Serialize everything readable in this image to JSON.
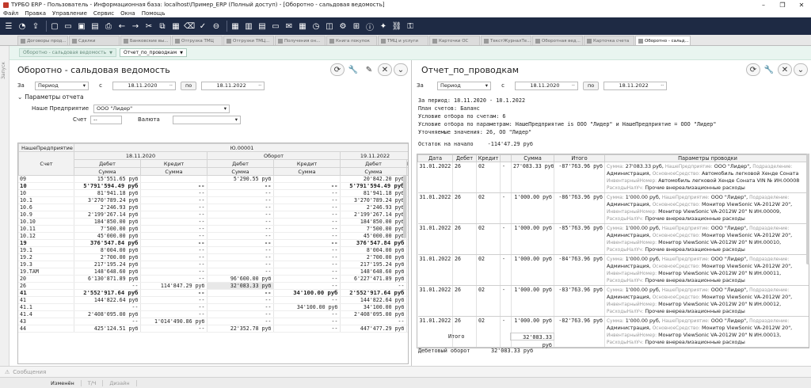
{
  "window": {
    "title": "ТУРБО ERP - Пользователь - Информационная база: localhost\\Пример_ERP (Полный доступ) - [Оборотно - сальдовая ведомость]"
  },
  "menu": [
    "Файл",
    "Правка",
    "Управление",
    "Сервис",
    "Окна",
    "Помощь"
  ],
  "doc_tabs": [
    {
      "label": "Договоры прод..."
    },
    {
      "label": "Сделки"
    },
    {
      "label": "Банковские вы..."
    },
    {
      "label": "Отгрузка ТМЦ"
    },
    {
      "label": "Отгрузки ТМЦ..."
    },
    {
      "label": "Получения он..."
    },
    {
      "label": "Книга покупок"
    },
    {
      "label": "ТМЦ и услуги"
    },
    {
      "label": "Карточки ОС"
    },
    {
      "label": "ТекстЖурналТе..."
    },
    {
      "label": "Оборотная вед..."
    },
    {
      "label": "Карточка счета"
    },
    {
      "label": "Оборотно - сальд..."
    }
  ],
  "left_rail_label": "Запуск",
  "sub_tabs": [
    {
      "label": "Оборотно - сальдовая ведомость"
    },
    {
      "label": "Отчет_по_проводкам"
    }
  ],
  "left": {
    "title": "Оборотно - сальдовая ведомость",
    "za": "За",
    "period_select": "Период",
    "s": "с",
    "date_from": "18.11.2020",
    "po_button": "по",
    "date_to": "18.11.2022",
    "params_header": "Параметры отчета",
    "company_label": "Наше Предприятие",
    "company_value": "ООО \"Лидер\"",
    "account_label": "Счет",
    "account_value": "--",
    "currency_label": "Валюта",
    "header": {
      "company": "НашеПредприятие",
      "account": "Счет",
      "group": "Ю.00001",
      "date1": "18.11.2020",
      "turnover": "Оборот",
      "date2": "19.11.2022",
      "debit": "Дебет",
      "credit": "Кредит",
      "sum": "Сумма",
      "k_cut": "К"
    },
    "rows": [
      {
        "a": "09",
        "d1": "15'551.65 руб",
        "k1": "",
        "d2": "5'290.55 руб",
        "k2": "",
        "d3": "20'842.20 руб",
        "style": "cut"
      },
      {
        "a": "10",
        "d1": "5'791'594.49 руб",
        "k1": "--",
        "d2": "--",
        "k2": "--",
        "d3": "5'791'594.49 руб",
        "style": "bold"
      },
      {
        "a": "10",
        "d1": "81'941.18 руб",
        "k1": "--",
        "d2": "--",
        "k2": "--",
        "d3": "81'941.18 руб"
      },
      {
        "a": "10.1",
        "d1": "3'270'789.24 руб",
        "k1": "--",
        "d2": "--",
        "k2": "--",
        "d3": "3'270'789.24 руб"
      },
      {
        "a": "10.6",
        "d1": "2'246.93 руб",
        "k1": "--",
        "d2": "--",
        "k2": "--",
        "d3": "2'246.93 руб"
      },
      {
        "a": "10.9",
        "d1": "2'199'267.14 руб",
        "k1": "--",
        "d2": "--",
        "k2": "--",
        "d3": "2'199'267.14 руб"
      },
      {
        "a": "10.10",
        "d1": "184'850.00 руб",
        "k1": "--",
        "d2": "--",
        "k2": "--",
        "d3": "184'850.00 руб"
      },
      {
        "a": "10.11",
        "d1": "7'500.00 руб",
        "k1": "--",
        "d2": "--",
        "k2": "--",
        "d3": "7'500.00 руб"
      },
      {
        "a": "10.12",
        "d1": "45'000.00 руб",
        "k1": "--",
        "d2": "--",
        "k2": "--",
        "d3": "45'000.00 руб"
      },
      {
        "a": "19",
        "d1": "376'547.84 руб",
        "k1": "--",
        "d2": "--",
        "k2": "--",
        "d3": "376'547.84 руб",
        "style": "bold"
      },
      {
        "a": "19.1",
        "d1": "8'004.00 руб",
        "k1": "--",
        "d2": "--",
        "k2": "--",
        "d3": "8'004.00 руб"
      },
      {
        "a": "19.2",
        "d1": "2'700.00 руб",
        "k1": "--",
        "d2": "--",
        "k2": "--",
        "d3": "2'700.00 руб"
      },
      {
        "a": "19.3",
        "d1": "217'195.24 руб",
        "k1": "--",
        "d2": "--",
        "k2": "--",
        "d3": "217'195.24 руб"
      },
      {
        "a": "19.ТАМ",
        "d1": "148'648.60 руб",
        "k1": "--",
        "d2": "--",
        "k2": "--",
        "d3": "148'648.60 руб"
      },
      {
        "a": "20",
        "d1": "6'130'871.89 руб",
        "k1": "--",
        "d2": "96'600.00 руб",
        "k2": "--",
        "d3": "6'227'471.89 руб"
      },
      {
        "a": "26",
        "d1": "--",
        "k1": "114'847.29 руб",
        "d2": "32'083.33 руб",
        "k2": "--",
        "d3": "--",
        "style": "hl"
      },
      {
        "a": "41",
        "d1": "2'552'917.64 руб",
        "k1": "--",
        "d2": "--",
        "k2": "34'100.00 руб",
        "d3": "2'552'917.64 руб",
        "style": "bold"
      },
      {
        "a": "41",
        "d1": "144'822.64 руб",
        "k1": "--",
        "d2": "--",
        "k2": "--",
        "d3": "144'822.64 руб"
      },
      {
        "a": "41.1",
        "d1": "--",
        "k1": "--",
        "d2": "--",
        "k2": "34'100.00 руб",
        "d3": "34'100.00 руб"
      },
      {
        "a": "41.4",
        "d1": "2'408'095.00 руб",
        "k1": "--",
        "d2": "--",
        "k2": "--",
        "d3": "2'408'095.00 руб"
      },
      {
        "a": "43",
        "d1": "--",
        "k1": "1'014'490.86 руб",
        "d2": "--",
        "k2": "--",
        "d3": "--"
      },
      {
        "a": "44",
        "d1": "425'124.51 руб",
        "k1": "--",
        "d2": "22'352.78 руб",
        "k2": "--",
        "d3": "447'477.29 руб"
      }
    ]
  },
  "right": {
    "title": "Отчет_по_проводкам",
    "za": "За",
    "period_select": "Период",
    "s": "с",
    "date_from": "18.11.2020",
    "po_button": "по",
    "date_to": "18.11.2022",
    "report_lines": [
      "За период: 18.11.2020 - 18.1.2022",
      "План счетов: Баланс",
      "Условие отбора по счетам: 6",
      "Условие отбора по параметрам: НашеПредприятие is ООО \"Лидер\" и НашеПредприятие = ООО \"Лидер\"",
      "Уточняемые значения: 26, ОО \"Лидер\""
    ],
    "opening_label": "Остаток на начало",
    "opening_value": "-114'47.29 руб",
    "columns": [
      "Дата",
      "Дебет",
      "Кредит",
      "",
      "Сумма",
      "Итого",
      "Параметры проводки"
    ],
    "entries": [
      {
        "date": "31.01.2022",
        "debit": "26",
        "credit": "02",
        "mark": "-",
        "sum": "27'083.33 руб",
        "total": "-87'763.96 руб",
        "p1_label": "Сумма:",
        "p1_value": "27'083.33 руб,",
        "p2_label": "НашеПредприятие:",
        "p2_value": "ООО \"Лидер\",",
        "p3_label": "Подразделение:",
        "l2_value": "Администрация,",
        "l2_label": "ОсновноеСредство:",
        "l2_asset": "Автомобиль легковой Хенде Соната",
        "l3_label": "ИнвентарныйНомер:",
        "l3_value": "Автомобиль легковой Хенде Соната VIN № ИН.00008",
        "l4_label": "РасходыНалУч:",
        "l4_value": "Прочие внереализационные расходы"
      },
      {
        "date": "31.01.2022",
        "debit": "26",
        "credit": "02",
        "mark": "-",
        "sum": "1'000.00 руб",
        "total": "-86'763.96 руб",
        "p1_label": "Сумма:",
        "p1_value": "1'000.00 руб,",
        "p2_label": "НашеПредприятие:",
        "p2_value": "ООО \"Лидер\",",
        "p3_label": "Подразделение:",
        "l2_value": "Администрация,",
        "l2_label": "ОсновноеСредство:",
        "l2_asset": "Монитор ViewSonic VA-2012W 20\",",
        "l3_label": "ИнвентарныйНомер:",
        "l3_value": "Монитор ViewSonic VA-2012W 20\" N ИН.00009,",
        "l4_label": "РасходыНалУч:",
        "l4_value": "Прочие внереализационные расходы"
      },
      {
        "date": "31.01.2022",
        "debit": "26",
        "credit": "02",
        "mark": "-",
        "sum": "1'000.00 руб",
        "total": "-85'763.96 руб",
        "p1_label": "Сумма:",
        "p1_value": "1'000.00 руб,",
        "p2_label": "НашеПредприятие:",
        "p2_value": "ООО \"Лидер\",",
        "p3_label": "Подразделение:",
        "l2_value": "Администрация,",
        "l2_label": "ОсновноеСредство:",
        "l2_asset": "Монитор ViewSonic VA-2012W 20\",",
        "l3_label": "ИнвентарныйНомер:",
        "l3_value": "Монитор ViewSonic VA-2012W 20\" N ИН.00010,",
        "l4_label": "РасходыНалУч:",
        "l4_value": "Прочие внереализационные расходы"
      },
      {
        "date": "31.01.2022",
        "debit": "26",
        "credit": "02",
        "mark": "-",
        "sum": "1'000.00 руб",
        "total": "-84'763.96 руб",
        "p1_label": "Сумма:",
        "p1_value": "1'000.00 руб,",
        "p2_label": "НашеПредприятие:",
        "p2_value": "ООО \"Лидер\",",
        "p3_label": "Подразделение:",
        "l2_value": "Администрация,",
        "l2_label": "ОсновноеСредство:",
        "l2_asset": "Монитор ViewSonic VA-2012W 20\",",
        "l3_label": "ИнвентарныйНомер:",
        "l3_value": "Монитор ViewSonic VA-2012W 20\" N ИН.00011,",
        "l4_label": "РасходыНалУч:",
        "l4_value": "Прочие внереализационные расходы"
      },
      {
        "date": "31.01.2022",
        "debit": "26",
        "credit": "02",
        "mark": "-",
        "sum": "1'000.00 руб",
        "total": "-83'763.96 руб",
        "p1_label": "Сумма:",
        "p1_value": "1'000.00 руб,",
        "p2_label": "НашеПредприятие:",
        "p2_value": "ООО \"Лидер\",",
        "p3_label": "Подразделение:",
        "l2_value": "Администрация,",
        "l2_label": "ОсновноеСредство:",
        "l2_asset": "Монитор ViewSonic VA-2012W 20\",",
        "l3_label": "ИнвентарныйНомер:",
        "l3_value": "Монитор ViewSonic VA-2012W 20\" N ИН.00012,",
        "l4_label": "РасходыНалУч:",
        "l4_value": "Прочие внереализационные расходы"
      },
      {
        "date": "31.01.2022",
        "debit": "26",
        "credit": "02",
        "mark": "-",
        "sum": "1'000.00 руб",
        "total": "-82'763.96 руб",
        "p1_label": "Сумма:",
        "p1_value": "1'000.00 руб,",
        "p2_label": "НашеПредприятие:",
        "p2_value": "ООО \"Лидер\",",
        "p3_label": "Подразделение:",
        "l2_value": "Администрация,",
        "l2_label": "ОсновноеСредство:",
        "l2_asset": "Монитор ViewSonic VA-2012W 20\",",
        "l3_label": "ИнвентарныйНомер:",
        "l3_value": "Монитор ViewSonic VA-2012W 20\" N ИН.00013,",
        "l4_label": "РасходыНалУч:",
        "l4_value": "Прочие внереализационные расходы"
      }
    ],
    "total_label": "Итого",
    "total_value": "32'083.33 руб",
    "debit_turnover_label": "Дебетовый оборот",
    "debit_turnover_value": "32'083.33 руб"
  },
  "messages_label": "Сообщения",
  "status": [
    "Изменён",
    "Т/Ч",
    "Дизайн"
  ],
  "colors": {
    "toolbar_bg": "#1e2a44",
    "subtab_bg": "#e9f5f0",
    "accent": "#c0392b"
  }
}
